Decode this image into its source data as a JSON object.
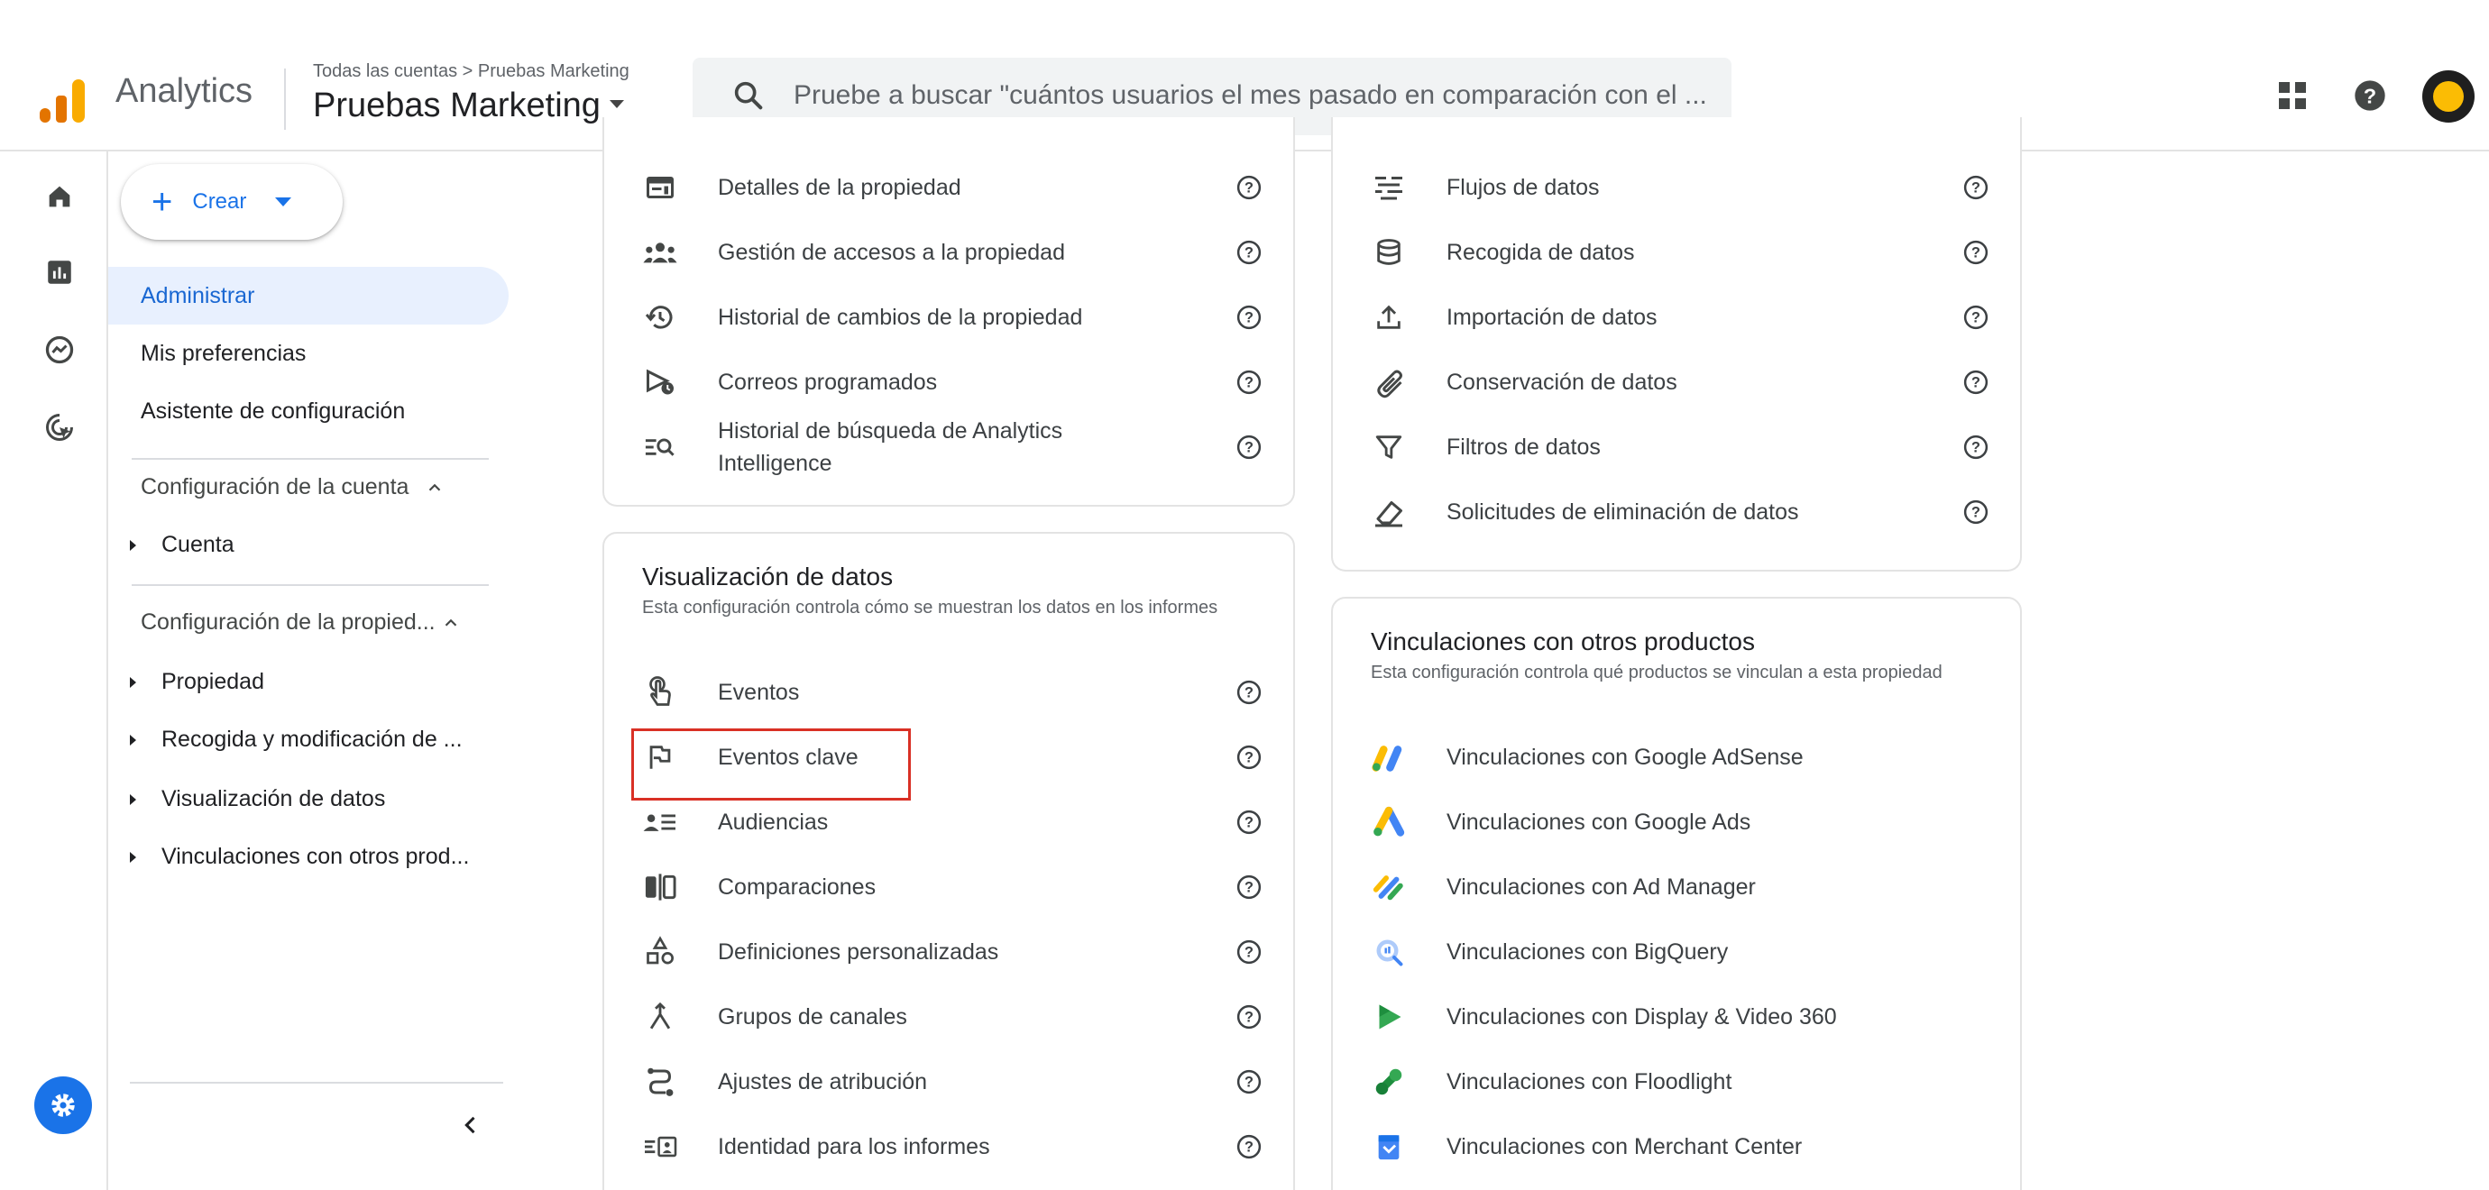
{
  "header": {
    "app_name": "Analytics",
    "breadcrumb": "Todas las cuentas > Pruebas Marketing",
    "property_name": "Pruebas Marketing",
    "search_placeholder": "Pruebe a buscar \"cuántos usuarios el mes pasado en comparación con el ...",
    "icons": [
      "apps-grid-icon",
      "help-icon",
      "account-avatar"
    ]
  },
  "rail": {
    "icons": [
      "home-icon",
      "reports-icon",
      "explore-icon",
      "advertising-icon",
      "admin-gear-icon"
    ]
  },
  "nav": {
    "create_label": "Crear",
    "items": [
      {
        "label": "Administrar",
        "active": true
      },
      {
        "label": "Mis preferencias",
        "active": false
      },
      {
        "label": "Asistente de configuración",
        "active": false
      }
    ],
    "account_section": {
      "title": "Configuración de la cuenta",
      "items": [
        "Cuenta"
      ]
    },
    "property_section": {
      "title": "Configuración de la propied...",
      "items": [
        "Propiedad",
        "Recogida y modificación de ...",
        "Visualización de datos",
        "Vinculaciones con otros prod..."
      ]
    }
  },
  "property_card": {
    "items": [
      {
        "icon": "property-details-icon",
        "label": "Detalles de la propiedad"
      },
      {
        "icon": "access-management-icon",
        "label": "Gestión de accesos a la propiedad"
      },
      {
        "icon": "history-icon",
        "label": "Historial de cambios de la propiedad"
      },
      {
        "icon": "scheduled-email-icon",
        "label": "Correos programados"
      },
      {
        "icon": "search-history-icon",
        "label": "Historial de búsqueda de Analytics Intelligence"
      }
    ]
  },
  "data_display_card": {
    "title": "Visualización de datos",
    "description": "Esta configuración controla cómo se muestran los datos en los informes",
    "items": [
      {
        "icon": "touch-icon",
        "label": "Eventos"
      },
      {
        "icon": "flag-icon",
        "label": "Eventos clave"
      },
      {
        "icon": "audiences-icon",
        "label": "Audiencias"
      },
      {
        "icon": "comparisons-icon",
        "label": "Comparaciones"
      },
      {
        "icon": "custom-definitions-icon",
        "label": "Definiciones personalizadas"
      },
      {
        "icon": "channel-groups-icon",
        "label": "Grupos de canales"
      },
      {
        "icon": "attribution-icon",
        "label": "Ajustes de atribución"
      },
      {
        "icon": "reporting-identity-icon",
        "label": "Identidad para los informes"
      }
    ]
  },
  "data_collection_card": {
    "items": [
      {
        "icon": "data-streams-icon",
        "label": "Flujos de datos"
      },
      {
        "icon": "database-icon",
        "label": "Recogida de datos"
      },
      {
        "icon": "upload-icon",
        "label": "Importación de datos"
      },
      {
        "icon": "retention-icon",
        "label": "Conservación de datos"
      },
      {
        "icon": "filter-icon",
        "label": "Filtros de datos"
      },
      {
        "icon": "eraser-icon",
        "label": "Solicitudes de eliminación de datos"
      }
    ]
  },
  "links_card": {
    "title": "Vinculaciones con otros productos",
    "description": "Esta configuración controla qué productos se vinculan a esta propiedad",
    "items": [
      {
        "icon": "adsense-icon",
        "label": "Vinculaciones con Google AdSense"
      },
      {
        "icon": "google-ads-icon",
        "label": "Vinculaciones con Google Ads"
      },
      {
        "icon": "ad-manager-icon",
        "label": "Vinculaciones con Ad Manager"
      },
      {
        "icon": "bigquery-icon",
        "label": "Vinculaciones con BigQuery"
      },
      {
        "icon": "display-video-360-icon",
        "label": "Vinculaciones con Display & Video 360"
      },
      {
        "icon": "floodlight-icon",
        "label": "Vinculaciones con Floodlight"
      },
      {
        "icon": "merchant-center-icon",
        "label": "Vinculaciones con Merchant Center"
      }
    ]
  },
  "colors": {
    "accent": "#1a73e8",
    "active_nav_bg": "#e8f0fe",
    "highlight_box": "#d93025"
  }
}
